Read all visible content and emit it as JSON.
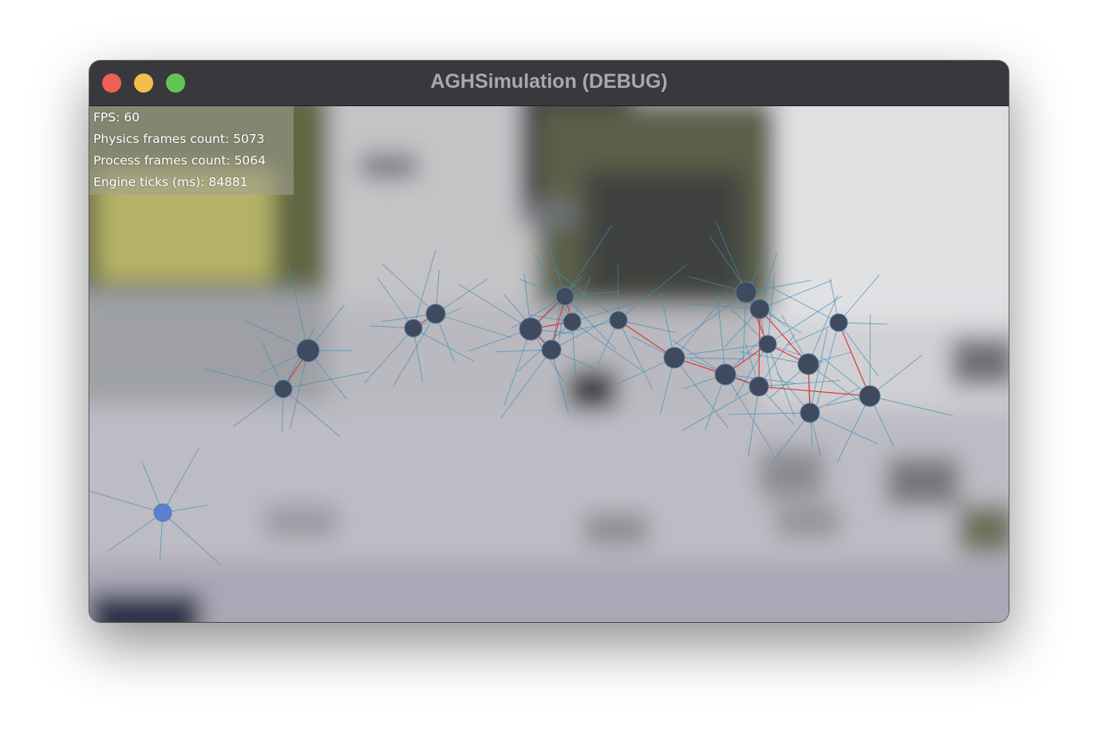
{
  "window": {
    "title": "AGHSimulation (DEBUG)",
    "controls": [
      "close",
      "minimize",
      "maximize"
    ]
  },
  "debug_overlay": {
    "fps": "FPS: 60",
    "physics_frames": "Physics frames count: 5073",
    "process_frames": "Process frames count: 5064",
    "engine_ticks": "Engine ticks (ms): 84881"
  },
  "colors": {
    "agent": "#3f4a5e",
    "agent_outline": "#5a7da3",
    "selected_agent": "#5b7fd1",
    "ray": "#3f8fb5",
    "link": "#d93a3a"
  }
}
